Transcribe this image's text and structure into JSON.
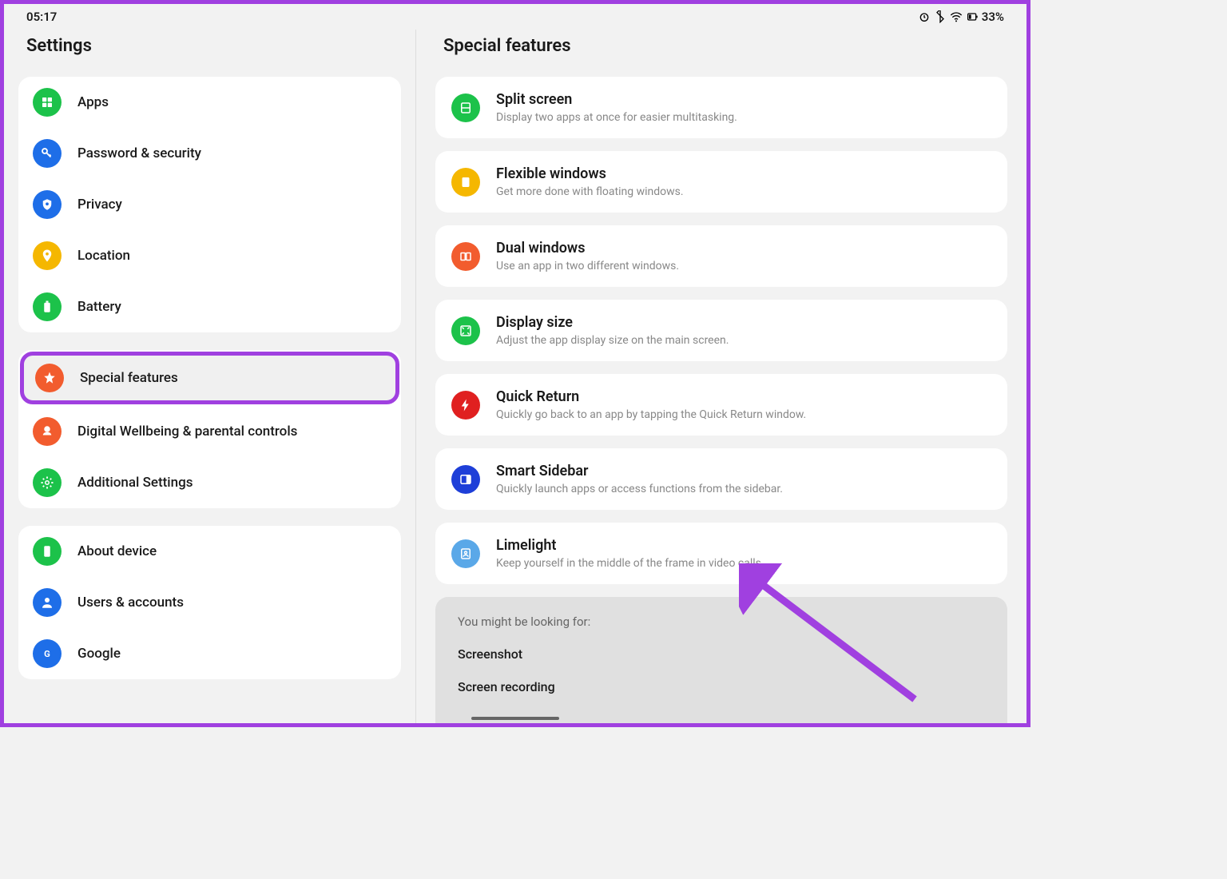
{
  "status": {
    "time": "05:17",
    "battery": "33%"
  },
  "left": {
    "title": "Settings",
    "group1": [
      {
        "label": "Apps",
        "color": "#1cc24a",
        "icon": "grid"
      },
      {
        "label": "Password & security",
        "color": "#1e6ee8",
        "icon": "key"
      },
      {
        "label": "Privacy",
        "color": "#1e6ee8",
        "icon": "shield"
      },
      {
        "label": "Location",
        "color": "#f5b700",
        "icon": "pin"
      },
      {
        "label": "Battery",
        "color": "#1cc24a",
        "icon": "battery"
      }
    ],
    "group2": [
      {
        "label": "Special features",
        "color": "#f25c2e",
        "icon": "star",
        "selected": true
      },
      {
        "label": "Digital Wellbeing & parental controls",
        "color": "#f25c2e",
        "icon": "heart"
      },
      {
        "label": "Additional Settings",
        "color": "#1cc24a",
        "icon": "gear"
      }
    ],
    "group3": [
      {
        "label": "About device",
        "color": "#1cc24a",
        "icon": "phone"
      },
      {
        "label": "Users & accounts",
        "color": "#1e6ee8",
        "icon": "user"
      },
      {
        "label": "Google",
        "color": "#1e6ee8",
        "icon": "g"
      }
    ]
  },
  "right": {
    "title": "Special features",
    "features": [
      {
        "title": "Split screen",
        "desc": "Display two apps at once for easier multitasking.",
        "color": "#1cc24a",
        "icon": "split"
      },
      {
        "title": "Flexible windows",
        "desc": "Get more done with floating windows.",
        "color": "#f5b700",
        "icon": "window"
      },
      {
        "title": "Dual windows",
        "desc": "Use an app in two different windows.",
        "color": "#f25c2e",
        "icon": "dual"
      },
      {
        "title": "Display size",
        "desc": "Adjust the app display size on the main screen.",
        "color": "#1cc24a",
        "icon": "expand"
      },
      {
        "title": "Quick Return",
        "desc": "Quickly go back to an app by tapping the Quick Return window.",
        "color": "#e02020",
        "icon": "bolt"
      },
      {
        "title": "Smart Sidebar",
        "desc": "Quickly launch apps or access functions from the sidebar.",
        "color": "#1e3fd8",
        "icon": "sidebar"
      },
      {
        "title": "Limelight",
        "desc": "Keep yourself in the middle of the frame in video calls.",
        "color": "#5aa8e8",
        "icon": "portrait"
      }
    ],
    "suggestions": {
      "header": "You might be looking for:",
      "items": [
        "Screenshot",
        "Screen recording"
      ]
    }
  }
}
